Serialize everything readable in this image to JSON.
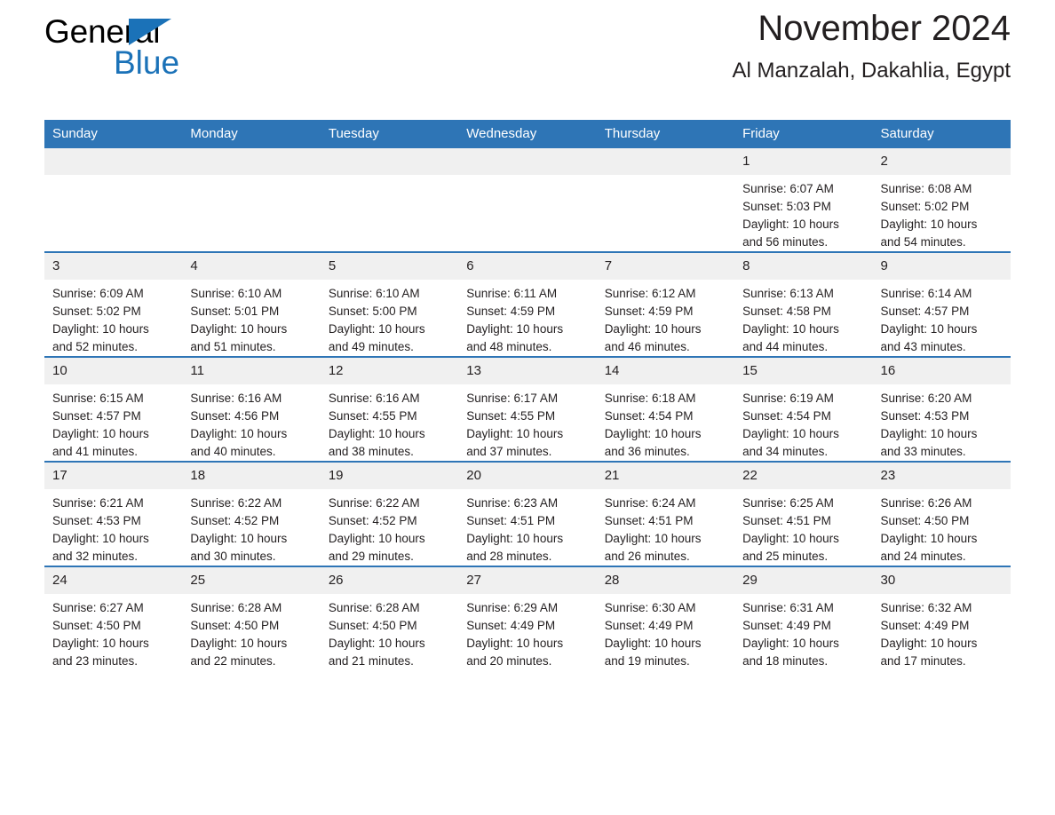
{
  "brand": {
    "name_line1": "General",
    "name_line2": "Blue",
    "flag_icon": "triangle-flag-icon",
    "accent_color": "#1b72b8"
  },
  "header": {
    "title": "November 2024",
    "subtitle": "Al Manzalah, Dakahlia, Egypt"
  },
  "theme": {
    "header_row_bg": "#2e75b6",
    "daynum_bg": "#f0f0f0",
    "text_color": "#231f20"
  },
  "weekday_headers": [
    "Sunday",
    "Monday",
    "Tuesday",
    "Wednesday",
    "Thursday",
    "Friday",
    "Saturday"
  ],
  "weeks": [
    [
      {
        "day": "",
        "empty": true,
        "sunrise": "",
        "sunset": "",
        "daylight_line1": "",
        "daylight_line2": ""
      },
      {
        "day": "",
        "empty": true,
        "sunrise": "",
        "sunset": "",
        "daylight_line1": "",
        "daylight_line2": ""
      },
      {
        "day": "",
        "empty": true,
        "sunrise": "",
        "sunset": "",
        "daylight_line1": "",
        "daylight_line2": ""
      },
      {
        "day": "",
        "empty": true,
        "sunrise": "",
        "sunset": "",
        "daylight_line1": "",
        "daylight_line2": ""
      },
      {
        "day": "",
        "empty": true,
        "sunrise": "",
        "sunset": "",
        "daylight_line1": "",
        "daylight_line2": ""
      },
      {
        "day": "1",
        "empty": false,
        "sunrise": "Sunrise: 6:07 AM",
        "sunset": "Sunset: 5:03 PM",
        "daylight_line1": "Daylight: 10 hours",
        "daylight_line2": "and 56 minutes."
      },
      {
        "day": "2",
        "empty": false,
        "sunrise": "Sunrise: 6:08 AM",
        "sunset": "Sunset: 5:02 PM",
        "daylight_line1": "Daylight: 10 hours",
        "daylight_line2": "and 54 minutes."
      }
    ],
    [
      {
        "day": "3",
        "empty": false,
        "sunrise": "Sunrise: 6:09 AM",
        "sunset": "Sunset: 5:02 PM",
        "daylight_line1": "Daylight: 10 hours",
        "daylight_line2": "and 52 minutes."
      },
      {
        "day": "4",
        "empty": false,
        "sunrise": "Sunrise: 6:10 AM",
        "sunset": "Sunset: 5:01 PM",
        "daylight_line1": "Daylight: 10 hours",
        "daylight_line2": "and 51 minutes."
      },
      {
        "day": "5",
        "empty": false,
        "sunrise": "Sunrise: 6:10 AM",
        "sunset": "Sunset: 5:00 PM",
        "daylight_line1": "Daylight: 10 hours",
        "daylight_line2": "and 49 minutes."
      },
      {
        "day": "6",
        "empty": false,
        "sunrise": "Sunrise: 6:11 AM",
        "sunset": "Sunset: 4:59 PM",
        "daylight_line1": "Daylight: 10 hours",
        "daylight_line2": "and 48 minutes."
      },
      {
        "day": "7",
        "empty": false,
        "sunrise": "Sunrise: 6:12 AM",
        "sunset": "Sunset: 4:59 PM",
        "daylight_line1": "Daylight: 10 hours",
        "daylight_line2": "and 46 minutes."
      },
      {
        "day": "8",
        "empty": false,
        "sunrise": "Sunrise: 6:13 AM",
        "sunset": "Sunset: 4:58 PM",
        "daylight_line1": "Daylight: 10 hours",
        "daylight_line2": "and 44 minutes."
      },
      {
        "day": "9",
        "empty": false,
        "sunrise": "Sunrise: 6:14 AM",
        "sunset": "Sunset: 4:57 PM",
        "daylight_line1": "Daylight: 10 hours",
        "daylight_line2": "and 43 minutes."
      }
    ],
    [
      {
        "day": "10",
        "empty": false,
        "sunrise": "Sunrise: 6:15 AM",
        "sunset": "Sunset: 4:57 PM",
        "daylight_line1": "Daylight: 10 hours",
        "daylight_line2": "and 41 minutes."
      },
      {
        "day": "11",
        "empty": false,
        "sunrise": "Sunrise: 6:16 AM",
        "sunset": "Sunset: 4:56 PM",
        "daylight_line1": "Daylight: 10 hours",
        "daylight_line2": "and 40 minutes."
      },
      {
        "day": "12",
        "empty": false,
        "sunrise": "Sunrise: 6:16 AM",
        "sunset": "Sunset: 4:55 PM",
        "daylight_line1": "Daylight: 10 hours",
        "daylight_line2": "and 38 minutes."
      },
      {
        "day": "13",
        "empty": false,
        "sunrise": "Sunrise: 6:17 AM",
        "sunset": "Sunset: 4:55 PM",
        "daylight_line1": "Daylight: 10 hours",
        "daylight_line2": "and 37 minutes."
      },
      {
        "day": "14",
        "empty": false,
        "sunrise": "Sunrise: 6:18 AM",
        "sunset": "Sunset: 4:54 PM",
        "daylight_line1": "Daylight: 10 hours",
        "daylight_line2": "and 36 minutes."
      },
      {
        "day": "15",
        "empty": false,
        "sunrise": "Sunrise: 6:19 AM",
        "sunset": "Sunset: 4:54 PM",
        "daylight_line1": "Daylight: 10 hours",
        "daylight_line2": "and 34 minutes."
      },
      {
        "day": "16",
        "empty": false,
        "sunrise": "Sunrise: 6:20 AM",
        "sunset": "Sunset: 4:53 PM",
        "daylight_line1": "Daylight: 10 hours",
        "daylight_line2": "and 33 minutes."
      }
    ],
    [
      {
        "day": "17",
        "empty": false,
        "sunrise": "Sunrise: 6:21 AM",
        "sunset": "Sunset: 4:53 PM",
        "daylight_line1": "Daylight: 10 hours",
        "daylight_line2": "and 32 minutes."
      },
      {
        "day": "18",
        "empty": false,
        "sunrise": "Sunrise: 6:22 AM",
        "sunset": "Sunset: 4:52 PM",
        "daylight_line1": "Daylight: 10 hours",
        "daylight_line2": "and 30 minutes."
      },
      {
        "day": "19",
        "empty": false,
        "sunrise": "Sunrise: 6:22 AM",
        "sunset": "Sunset: 4:52 PM",
        "daylight_line1": "Daylight: 10 hours",
        "daylight_line2": "and 29 minutes."
      },
      {
        "day": "20",
        "empty": false,
        "sunrise": "Sunrise: 6:23 AM",
        "sunset": "Sunset: 4:51 PM",
        "daylight_line1": "Daylight: 10 hours",
        "daylight_line2": "and 28 minutes."
      },
      {
        "day": "21",
        "empty": false,
        "sunrise": "Sunrise: 6:24 AM",
        "sunset": "Sunset: 4:51 PM",
        "daylight_line1": "Daylight: 10 hours",
        "daylight_line2": "and 26 minutes."
      },
      {
        "day": "22",
        "empty": false,
        "sunrise": "Sunrise: 6:25 AM",
        "sunset": "Sunset: 4:51 PM",
        "daylight_line1": "Daylight: 10 hours",
        "daylight_line2": "and 25 minutes."
      },
      {
        "day": "23",
        "empty": false,
        "sunrise": "Sunrise: 6:26 AM",
        "sunset": "Sunset: 4:50 PM",
        "daylight_line1": "Daylight: 10 hours",
        "daylight_line2": "and 24 minutes."
      }
    ],
    [
      {
        "day": "24",
        "empty": false,
        "sunrise": "Sunrise: 6:27 AM",
        "sunset": "Sunset: 4:50 PM",
        "daylight_line1": "Daylight: 10 hours",
        "daylight_line2": "and 23 minutes."
      },
      {
        "day": "25",
        "empty": false,
        "sunrise": "Sunrise: 6:28 AM",
        "sunset": "Sunset: 4:50 PM",
        "daylight_line1": "Daylight: 10 hours",
        "daylight_line2": "and 22 minutes."
      },
      {
        "day": "26",
        "empty": false,
        "sunrise": "Sunrise: 6:28 AM",
        "sunset": "Sunset: 4:50 PM",
        "daylight_line1": "Daylight: 10 hours",
        "daylight_line2": "and 21 minutes."
      },
      {
        "day": "27",
        "empty": false,
        "sunrise": "Sunrise: 6:29 AM",
        "sunset": "Sunset: 4:49 PM",
        "daylight_line1": "Daylight: 10 hours",
        "daylight_line2": "and 20 minutes."
      },
      {
        "day": "28",
        "empty": false,
        "sunrise": "Sunrise: 6:30 AM",
        "sunset": "Sunset: 4:49 PM",
        "daylight_line1": "Daylight: 10 hours",
        "daylight_line2": "and 19 minutes."
      },
      {
        "day": "29",
        "empty": false,
        "sunrise": "Sunrise: 6:31 AM",
        "sunset": "Sunset: 4:49 PM",
        "daylight_line1": "Daylight: 10 hours",
        "daylight_line2": "and 18 minutes."
      },
      {
        "day": "30",
        "empty": false,
        "sunrise": "Sunrise: 6:32 AM",
        "sunset": "Sunset: 4:49 PM",
        "daylight_line1": "Daylight: 10 hours",
        "daylight_line2": "and 17 minutes."
      }
    ]
  ]
}
